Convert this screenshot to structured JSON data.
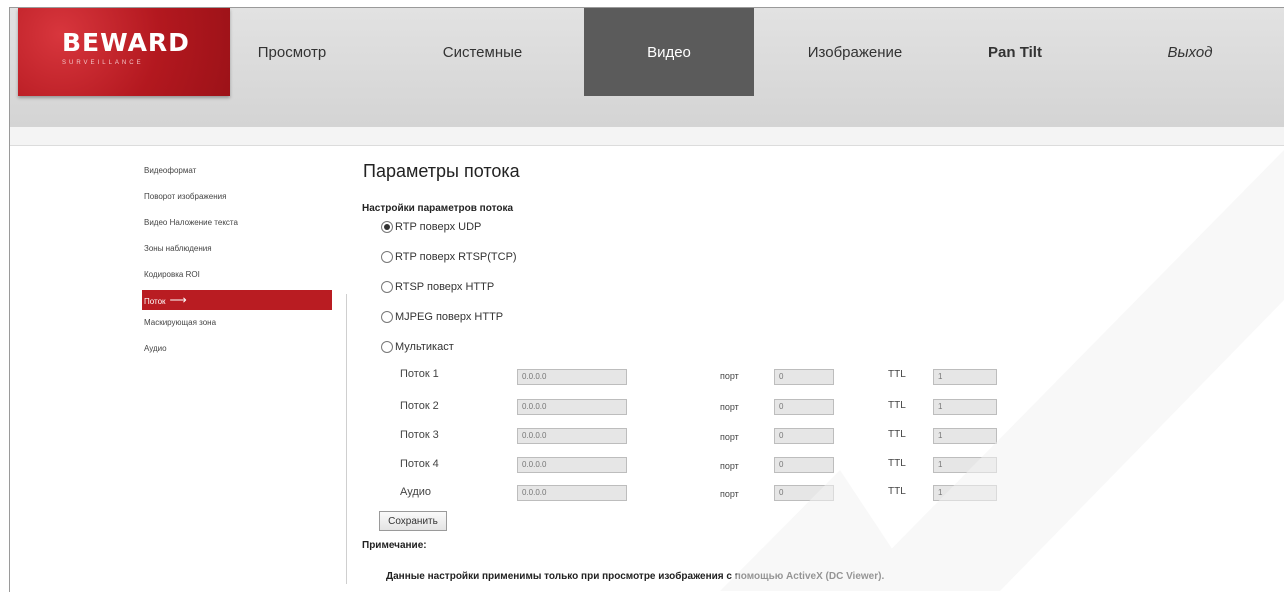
{
  "header": {
    "logo_text": "BEWARD",
    "logo_sub": "SURVEILLANCE",
    "nav": [
      {
        "label": "Просмотр"
      },
      {
        "label": "Системные"
      },
      {
        "label": "Видео"
      },
      {
        "label": "Изображение"
      },
      {
        "label": "Pan Tilt"
      },
      {
        "label": "Выход"
      }
    ],
    "active_nav": "Видео"
  },
  "sidebar": {
    "items": [
      {
        "label": "Видеоформат"
      },
      {
        "label": "Поворот изображения"
      },
      {
        "label": "Видео Наложение текста"
      },
      {
        "label": "Зоны наблюдения"
      },
      {
        "label": "Кодировка ROI"
      },
      {
        "label": "Поток"
      },
      {
        "label": "Маскирующая зона"
      },
      {
        "label": "Аудио"
      }
    ],
    "active_item": "Поток"
  },
  "main": {
    "title": "Параметры потока",
    "subtitle": "Настройки параметров потока",
    "radio_options": [
      {
        "label": "RTP поверх UDP",
        "checked": true
      },
      {
        "label": "RTP поверх RTSP(TCP)",
        "checked": false
      },
      {
        "label": "RTSP поверх HTTP",
        "checked": false
      },
      {
        "label": "MJPEG поверх HTTP",
        "checked": false
      },
      {
        "label": "Мультикаст",
        "checked": false
      }
    ],
    "port_label": "порт",
    "ttl_label": "TTL",
    "streams": [
      {
        "label": "Поток 1",
        "address": "0.0.0.0",
        "port": "0",
        "ttl": "1"
      },
      {
        "label": "Поток 2",
        "address": "0.0.0.0",
        "port": "0",
        "ttl": "1"
      },
      {
        "label": "Поток 3",
        "address": "0.0.0.0",
        "port": "0",
        "ttl": "1"
      },
      {
        "label": "Поток 4",
        "address": "0.0.0.0",
        "port": "0",
        "ttl": "1"
      },
      {
        "label": "Аудио",
        "address": "0.0.0.0",
        "port": "0",
        "ttl": "1"
      }
    ],
    "save_label": "Сохранить",
    "note_title": "Примечание:",
    "note_text": "Данные настройки применимы только при просмотре изображения с помощью ActiveX (DC Viewer)."
  },
  "colors": {
    "brand_red": "#b91c22",
    "nav_active_bg": "#5b5b5b",
    "header_bg": "#dcdcdc"
  }
}
